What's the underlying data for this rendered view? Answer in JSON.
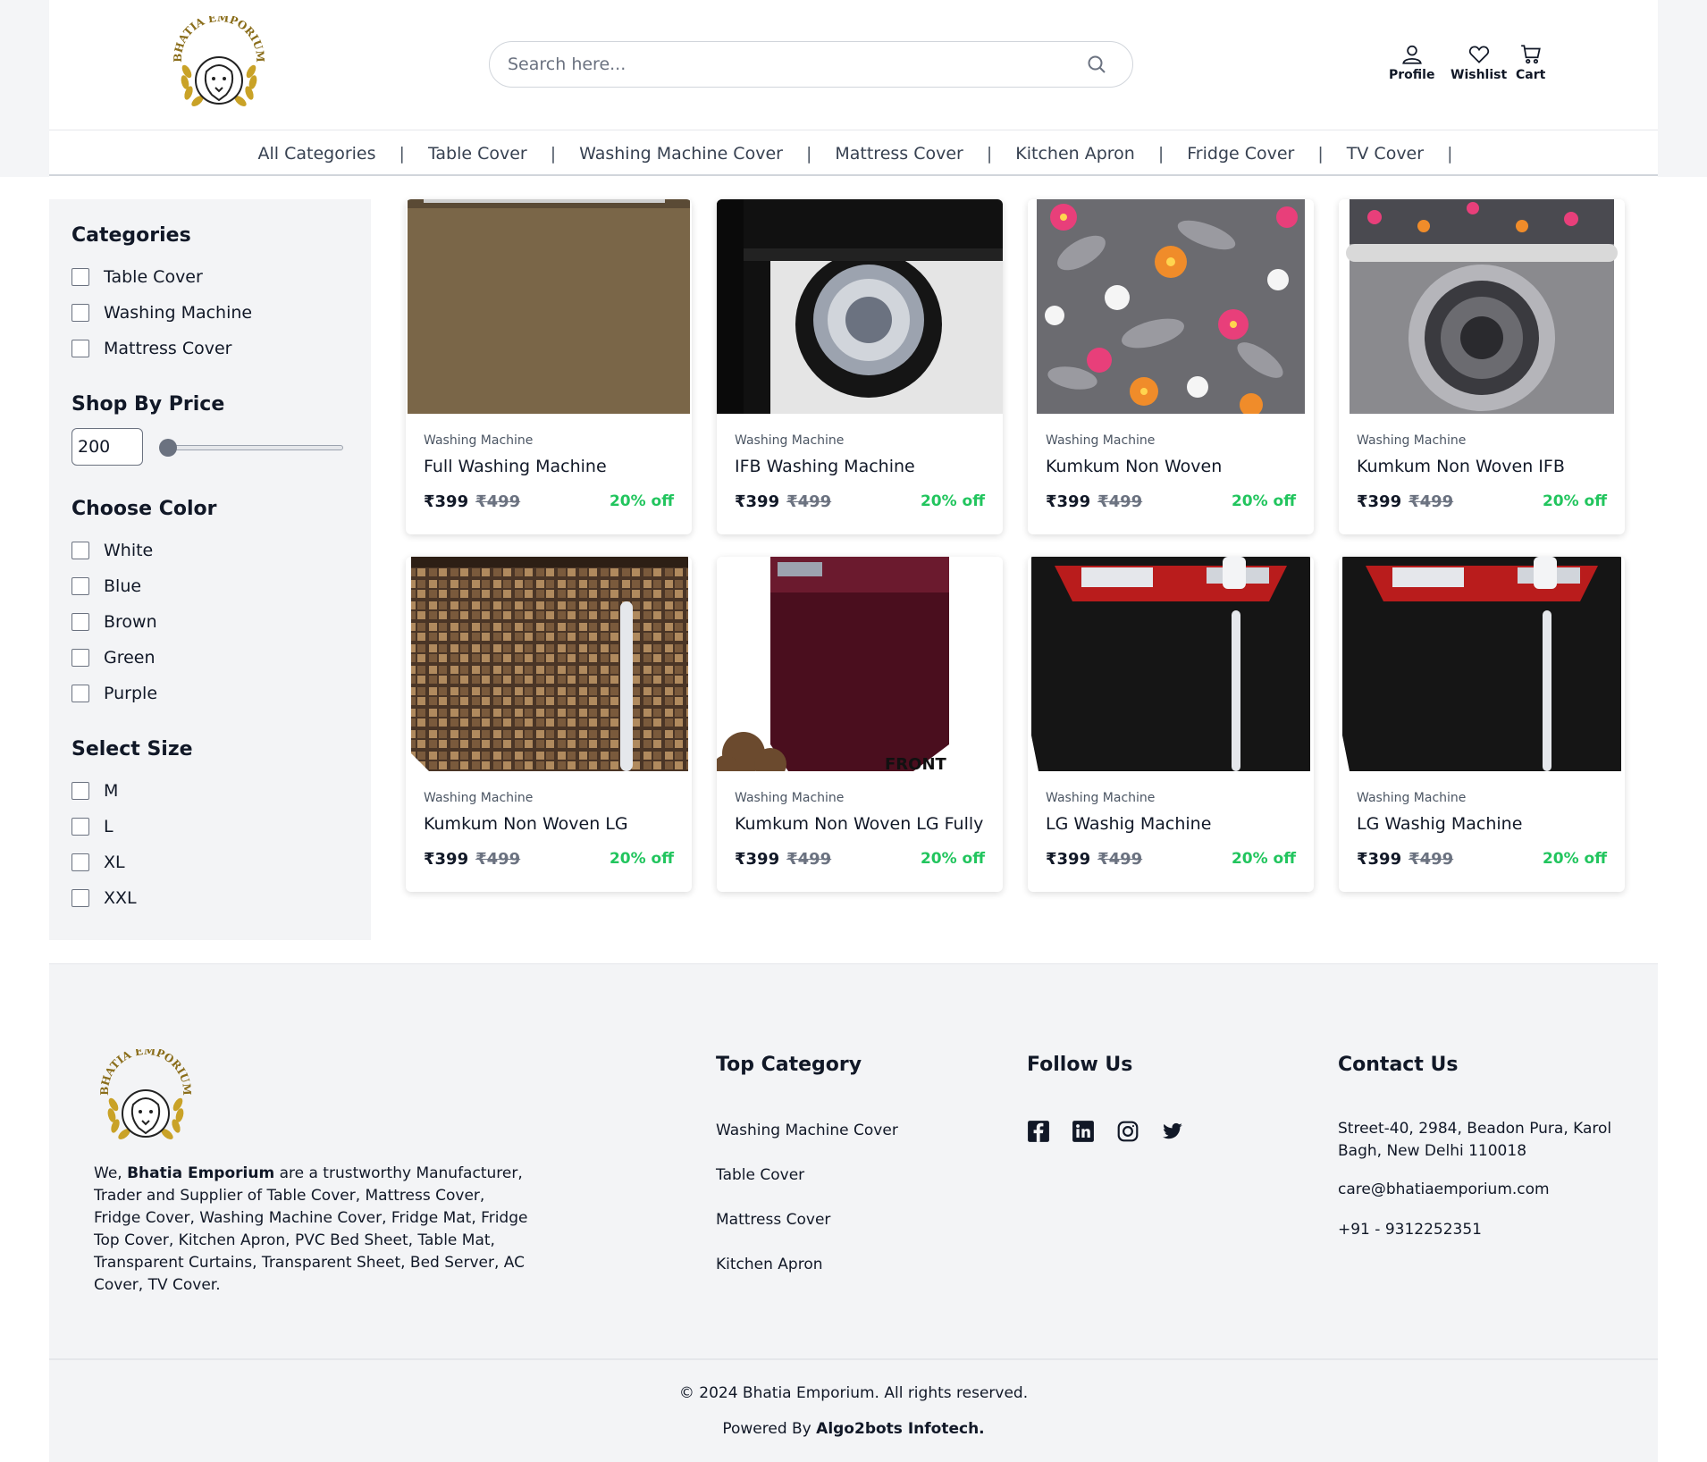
{
  "header": {
    "logo_text": "BHATIA EMPORIUM",
    "search_placeholder": "Search here...",
    "profile_label": "Profile",
    "wishlist_label": "Wishlist",
    "cart_label": "Cart"
  },
  "nav": {
    "items": [
      "All Categories",
      "Table Cover",
      "Washing Machine Cover",
      "Mattress Cover",
      "Kitchen Apron",
      "Fridge Cover",
      "TV Cover"
    ],
    "separator": "|"
  },
  "sidebar": {
    "categories_title": "Categories",
    "categories": [
      "Table Cover",
      "Washing Machine",
      "Mattress Cover"
    ],
    "price_title": "Shop By Price",
    "price_value": "200",
    "price_slider_fraction": 0.0,
    "color_title": "Choose Color",
    "colors": [
      "White",
      "Blue",
      "Brown",
      "Green",
      "Purple"
    ],
    "size_title": "Select Size",
    "sizes": [
      "M",
      "L",
      "XL",
      "XXL"
    ]
  },
  "products": [
    {
      "category": "Washing Machine",
      "name": "Full Washing Machine",
      "price": "₹399",
      "old_price": "₹499",
      "discount": "20% off",
      "image": "brown-plain-cover"
    },
    {
      "category": "Washing Machine",
      "name": "IFB Washing Machine",
      "price": "₹399",
      "old_price": "₹499",
      "discount": "20% off",
      "image": "black-front-load-cover"
    },
    {
      "category": "Washing Machine",
      "name": "Kumkum Non Woven",
      "price": "₹399",
      "old_price": "₹499",
      "discount": "20% off",
      "image": "grey-floral-fabric"
    },
    {
      "category": "Washing Machine",
      "name": "Kumkum Non Woven IFB",
      "price": "₹399",
      "old_price": "₹499",
      "discount": "20% off",
      "image": "floral-front-load-cover"
    },
    {
      "category": "Washing Machine",
      "name": "Kumkum Non Woven LG",
      "price": "₹399",
      "old_price": "₹499",
      "discount": "20% off",
      "image": "brown-check-cover"
    },
    {
      "category": "Washing Machine",
      "name": "Kumkum Non Woven LG Fully",
      "price": "₹399",
      "old_price": "₹499",
      "discount": "20% off",
      "image": "maroon-top-load-cover",
      "image_text": "FRONT"
    },
    {
      "category": "Washing Machine",
      "name": "LG Washig Machine",
      "price": "₹399",
      "old_price": "₹499",
      "discount": "20% off",
      "image": "black-top-load-cover"
    },
    {
      "category": "Washing Machine",
      "name": "LG Washig Machine",
      "price": "₹399",
      "old_price": "₹499",
      "discount": "20% off",
      "image": "black-top-load-cover"
    }
  ],
  "footer": {
    "about_prefix": "We, ",
    "about_brand": "Bhatia Emporium",
    "about_rest": " are a trustworthy Manufacturer, Trader and Supplier of Table Cover, Mattress Cover, Fridge Cover, Washing Machine Cover, Fridge Mat, Fridge Top Cover, Kitchen Apron, PVC Bed Sheet, Table Mat, Transparent Curtains, Transparent Sheet, Bed Server, AC Cover, TV Cover.",
    "top_category_title": "Top Category",
    "top_categories": [
      "Washing Machine Cover",
      "Table Cover",
      "Mattress Cover",
      "Kitchen Apron"
    ],
    "follow_title": "Follow Us",
    "social_icons": [
      "facebook-icon",
      "linkedin-icon",
      "instagram-icon",
      "twitter-icon"
    ],
    "contact_title": "Contact Us",
    "address": "Street-40, 2984, Beadon Pura, Karol Bagh, New Delhi 110018",
    "email": "care@bhatiaemporium.com",
    "phone": "+91 - 9312252351",
    "copyright": "© 2024 Bhatia Emporium. All rights reserved.",
    "powered_prefix": "Powered By ",
    "powered_company": "Algo2bots Infotech."
  },
  "colors": {
    "discount_green": "#22c55e",
    "sidebar_bg": "#f3f4f6",
    "logo_gold": "#c9a227"
  }
}
